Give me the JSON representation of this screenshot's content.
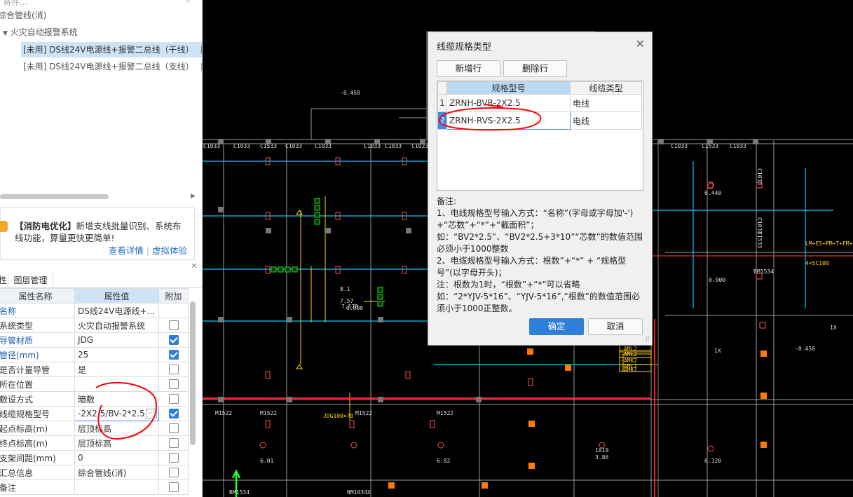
{
  "tree": {
    "search_partial": "将件...",
    "row_root": "综合管线(消)",
    "row_system": "火灾自动报警系统",
    "row_item1": "[未用] DS线24V电源线+报警二总线（干线）",
    "row_item1_suffix": "[J",
    "row_item2": "[未用] DS线24V电源线+报警二总线（支线）",
    "row_item2_suffix": "[J"
  },
  "promo": {
    "title": "【消防电优化】",
    "text": "新增支线批量识别、系统布线功能，算量更快更简单!",
    "link_detail": "查看详情",
    "link_demo": "虚拟体验"
  },
  "tabs": {
    "tab1": "性",
    "tab2": "图层管理"
  },
  "properties": {
    "headers": [
      "属性名称",
      "属性值",
      "附加"
    ],
    "rows": [
      {
        "name": "名称",
        "value": "DS线24V电源线+...",
        "checked": false,
        "blue": true,
        "show_cb": false
      },
      {
        "name": "系统类型",
        "value": "火灾自动报警系统",
        "checked": false,
        "blue": false,
        "show_cb": true
      },
      {
        "name": "导管材质",
        "value": "JDG",
        "checked": true,
        "blue": true,
        "show_cb": true
      },
      {
        "name": "管径(mm)",
        "value": "25",
        "checked": true,
        "blue": true,
        "show_cb": true
      },
      {
        "name": "是否计量导管",
        "value": "是",
        "checked": false,
        "blue": false,
        "show_cb": true
      },
      {
        "name": "所在位置",
        "value": "",
        "checked": false,
        "blue": false,
        "show_cb": true
      },
      {
        "name": "敷设方式",
        "value": "暗敷",
        "checked": false,
        "blue": false,
        "show_cb": true
      },
      {
        "name": "线缆规格型号",
        "value": "-2X2.5/BV-2*2.5",
        "checked": true,
        "blue": false,
        "show_cb": true
      },
      {
        "name": "起点标高(m)",
        "value": "层顶标高",
        "checked": false,
        "blue": false,
        "show_cb": true
      },
      {
        "name": "终点标高(m)",
        "value": "层顶标高",
        "checked": false,
        "blue": false,
        "show_cb": true
      },
      {
        "name": "支架间距(mm)",
        "value": "0",
        "checked": false,
        "blue": false,
        "show_cb": true
      },
      {
        "name": "汇总信息",
        "value": "综合管线(消)",
        "checked": false,
        "blue": false,
        "show_cb": true
      },
      {
        "name": "备注",
        "value": "",
        "checked": false,
        "blue": false,
        "show_cb": true
      }
    ]
  },
  "cad": {
    "labels": [
      "-0.450",
      "C1033",
      "C1533",
      "C1033",
      "C1033",
      "C1033",
      "C1023",
      "C1033",
      "C1533",
      "C1033",
      "C1033",
      "C1033",
      "C1033",
      "C1033",
      "C1533",
      "6.440",
      "8.1",
      "7.57",
      "7.578",
      "0.000",
      "0.000",
      "M1522",
      "M1522",
      "M1522",
      "M1522",
      "BM1534",
      "BM1534",
      "6.01",
      "6.82",
      "6.120",
      "1019",
      "3.86",
      "BM1034X",
      "LM+ES+PM+T+FM+4(S+D)+",
      "4×SC100",
      "-AML2",
      "-AML1",
      "-AMK2",
      "-AMK1",
      "1X",
      "-0.450",
      "1X",
      "-AML2",
      "JDG100×70"
    ]
  },
  "dialog": {
    "title": "线缆规格类型",
    "add_row": "新增行",
    "delete_row": "删除行",
    "col_model": "规格型号",
    "col_type": "线缆类型",
    "rows": [
      {
        "idx": "1",
        "model": "ZRNH-BVR-2X2.5",
        "type": "电线"
      },
      {
        "idx": "2",
        "model": "ZRNH-RVS-2X2.5",
        "type": "电线"
      }
    ],
    "notes_title": "备注:",
    "notes": [
      "1、电线规格型号输入方式：“名称”(字母或字母加'-') +“芯数”+“*”+“截面积”；",
      "如：“BV2*2.5”、“BV2*2.5+3*10”“芯数”的数值范围必须小于1000整数",
      "2、电缆规格型号输入方式：根数”+“*” + “规格型号”(以字母开头)；",
      "注：根数为1时，“根数”+“*”可以省略",
      "如：“2*YJV-5*16”、“YJV-5*16”,“根数”的数值范围必须小于1000正整数。"
    ],
    "ok": "确定",
    "cancel": "取消"
  }
}
